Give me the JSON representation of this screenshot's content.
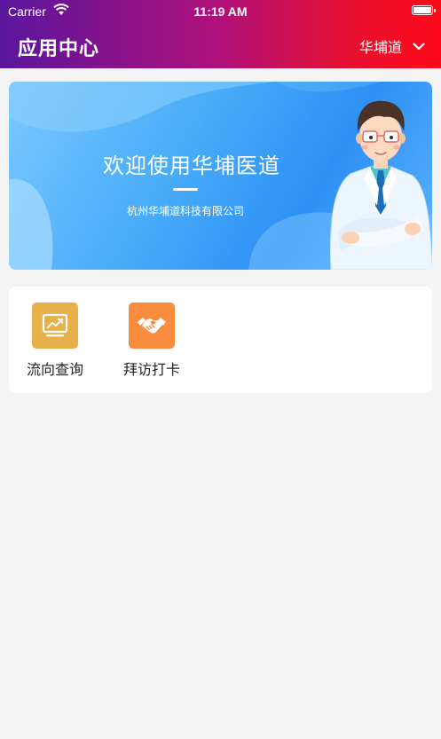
{
  "status_bar": {
    "carrier": "Carrier",
    "time": "11:19 AM"
  },
  "header": {
    "title": "应用中心",
    "org_name": "华埔道"
  },
  "banner": {
    "title": "欢迎使用华埔医道",
    "subtitle": "杭州华埔道科技有限公司"
  },
  "apps": [
    {
      "label": "流向查询",
      "icon": "chart-icon",
      "color": "#e8b04a"
    },
    {
      "label": "拜访打卡",
      "icon": "handshake-icon",
      "color": "#f98c3d"
    }
  ],
  "colors": {
    "background": "#f4f4f4",
    "header_start": "#5a169e",
    "header_end": "#ff0a1a",
    "banner_blue": "#3b9cf7"
  }
}
